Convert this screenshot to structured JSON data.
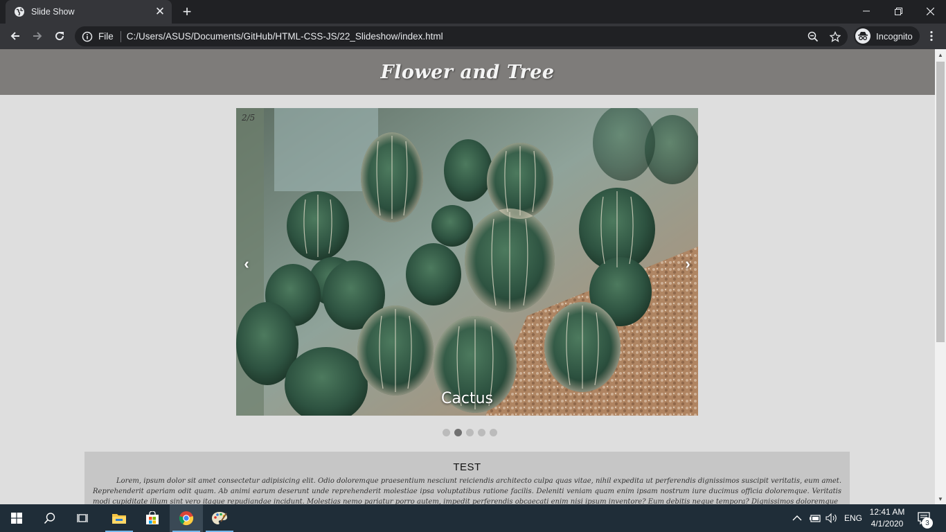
{
  "browser": {
    "tab_title": "Slide Show",
    "omnibox_scheme": "File",
    "url": "C:/Users/ASUS/Documents/GitHub/HTML-CSS-JS/22_Slideshow/index.html",
    "profile_label": "Incognito"
  },
  "page": {
    "title": "Flower and Tree",
    "slideshow": {
      "counter": "2/5",
      "caption": "Cactus",
      "prev_label": "‹",
      "next_label": "›",
      "dot_count": 5,
      "active_index": 1
    },
    "text_section": {
      "title": "TEST",
      "body": "Lorem, ipsum dolor sit amet consectetur adipisicing elit. Odio doloremque praesentium nesciunt reiciendis architecto culpa quas vitae, nihil expedita ut perferendis dignissimos suscipit veritatis, eum amet. Reprehenderit aperiam odit quam. Ab animi earum deserunt unde reprehenderit molestiae ipsa voluptatibus ratione facilis. Deleniti veniam quam enim ipsam nostrum iure ducimus officia doloremque. Veritatis modi cupiditate illum sint vero itaque repudiandae incidunt. Molestias nemo pariatur porro autem, impedit perferendis obcaecati enim nisi ipsum inventore? Eum debitis neque tempora? Dignissimos doloremque"
    }
  },
  "taskbar": {
    "language": "ENG",
    "time": "12:41 AM",
    "date": "4/1/2020",
    "notification_count": "3"
  },
  "colors": {
    "header_bg": "#7e7c7a",
    "page_bg": "#dedede",
    "textbox_bg": "#c6c6c6",
    "taskbar_bg": "#1f2d38"
  }
}
